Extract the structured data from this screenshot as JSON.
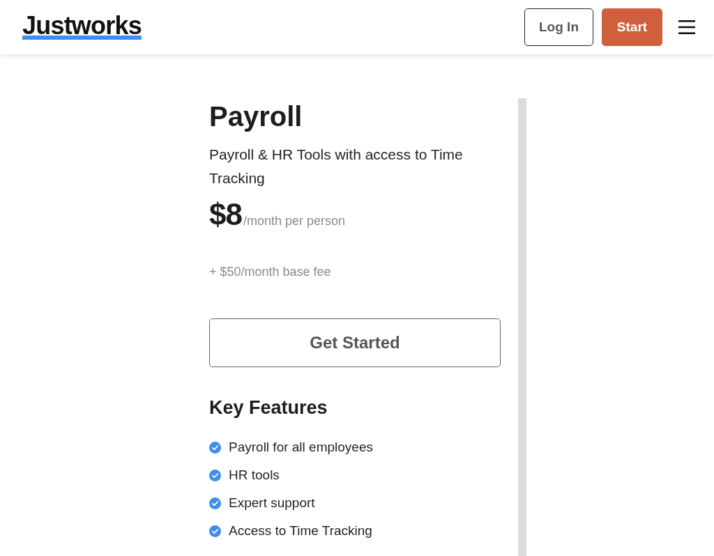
{
  "header": {
    "logo": "Justworks",
    "buttons": [
      {
        "label": "Log In",
        "kind": "outline"
      },
      {
        "label": "Start",
        "kind": "primary"
      }
    ]
  },
  "plan": {
    "title": "Payroll",
    "description": "Payroll & HR Tools with access to Time Tracking",
    "price": "$8",
    "price_unit": "/month per person",
    "base_fee": "+ $50/month base fee",
    "cta": "Get Started",
    "features_heading": "Key Features",
    "features": [
      "Payroll for all employees",
      "HR tools",
      "Expert support",
      "Access to Time Tracking"
    ]
  }
}
